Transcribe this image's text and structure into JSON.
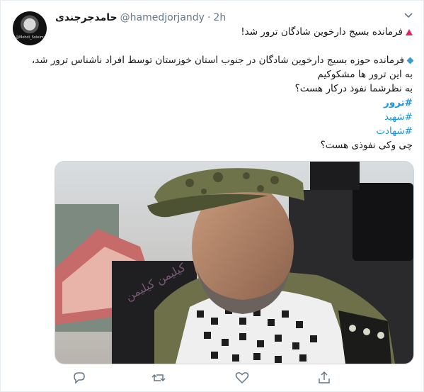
{
  "author": {
    "name": "حامدجرجندی",
    "handle": "@hamedjorjandy",
    "separator": "·",
    "time": "2h",
    "avatar_caption": "@Mehdi_Soleimani"
  },
  "tweet": {
    "line1": "فرمانده بسیج دارخوین شادگان ترور شد!",
    "line2": "فرمانده حوزه بسیج دارخوین شادگان در جنوب استان خوزستان توسط افراد ناشناس ترور شد،",
    "line3": "به این ترور ها مشکوکیم",
    "line4": "به نظرشما نفوذ درکار هست؟",
    "hashtags": [
      "#ترور",
      "#شهید",
      "#شهادت"
    ],
    "line5": "چی وکی نفوذی هست؟"
  },
  "media": {
    "watermark": "کیلیمن کیلیمن"
  },
  "icons": {
    "reply": "reply-icon",
    "retweet": "retweet-icon",
    "like": "heart-icon",
    "share": "share-icon",
    "more": "chevron-down-icon"
  },
  "colors": {
    "link": "#1b95e0",
    "red_triangle": "#e0245e",
    "blue_diamond": "#3d9ad1",
    "muted": "#657786"
  }
}
